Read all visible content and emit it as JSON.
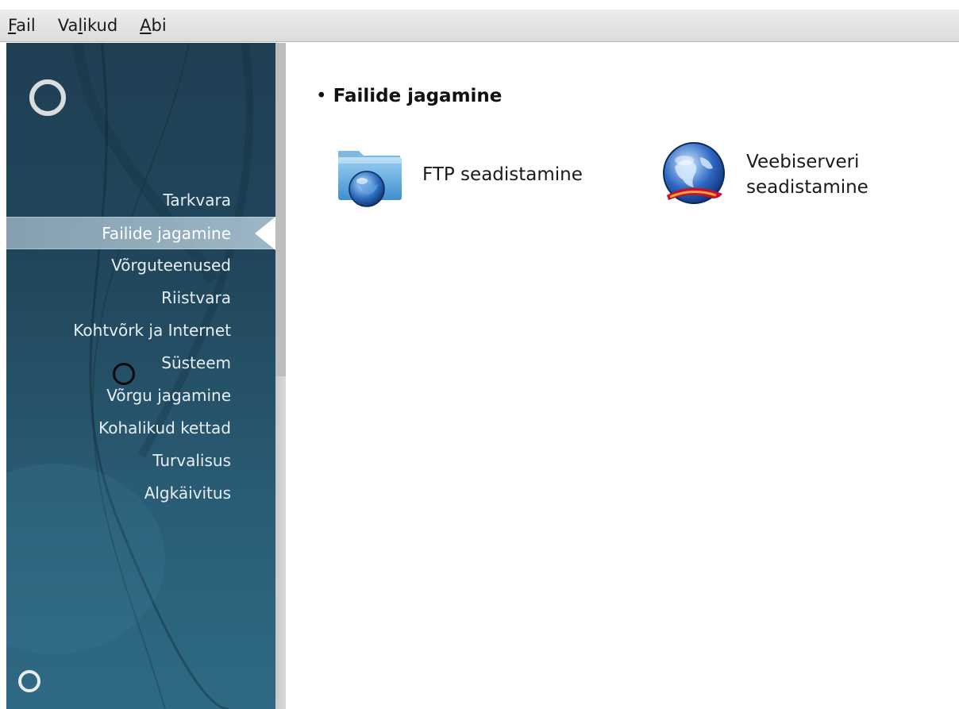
{
  "window": {
    "menu": [
      {
        "label": "Fail"
      },
      {
        "label": "Valikud"
      },
      {
        "label": "Abi"
      }
    ]
  },
  "sidebar": {
    "items": [
      {
        "label": "Tarkvara"
      },
      {
        "label": "Failide jagamine",
        "active": true
      },
      {
        "label": "Võrguteenused"
      },
      {
        "label": "Riistvara"
      },
      {
        "label": "Kohtvõrk ja Internet"
      },
      {
        "label": "Süsteem"
      },
      {
        "label": "Võrgu jagamine"
      },
      {
        "label": "Kohalikud kettad"
      },
      {
        "label": "Turvalisus"
      },
      {
        "label": "Algkäivitus"
      }
    ]
  },
  "main": {
    "section_title": "Failide jagamine",
    "tools": [
      {
        "label_line1": "FTP seadistamine",
        "label_line2": "",
        "icon": "ftp-folder-globe-icon"
      },
      {
        "label_line1": "Veebiserveri",
        "label_line2": "seadistamine",
        "icon": "web-server-globe-icon"
      }
    ]
  },
  "colors": {
    "sidebar_top": "#1f3f53",
    "sidebar_bottom": "#2e6a85",
    "active_item": "#a0b8c6",
    "menubar": "#e4e4e4"
  }
}
